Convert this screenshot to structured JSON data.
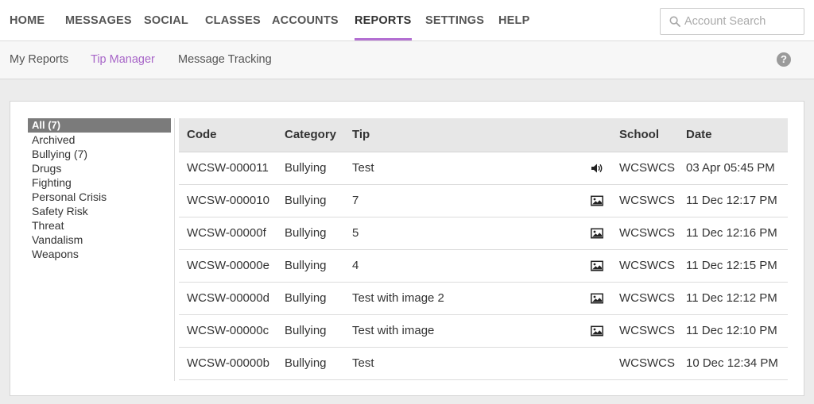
{
  "topnav": {
    "items": [
      {
        "label": "HOME",
        "active": false
      },
      {
        "label": "MESSAGES",
        "active": false
      },
      {
        "label": "SOCIAL",
        "active": false
      },
      {
        "label": "CLASSES",
        "active": false
      },
      {
        "label": "ACCOUNTS",
        "active": false
      },
      {
        "label": "REPORTS",
        "active": true
      },
      {
        "label": "SETTINGS",
        "active": false
      },
      {
        "label": "HELP",
        "active": false
      }
    ],
    "search_placeholder": "Account Search",
    "accent_color": "#b36fd2"
  },
  "subnav": {
    "items": [
      {
        "label": "My Reports",
        "active": false
      },
      {
        "label": "Tip Manager",
        "active": true
      },
      {
        "label": "Message Tracking",
        "active": false
      }
    ],
    "help_icon": "?"
  },
  "categories": [
    {
      "label": "All (7)",
      "selected": true
    },
    {
      "label": "Archived",
      "selected": false
    },
    {
      "label": "Bullying (7)",
      "selected": false
    },
    {
      "label": "Drugs",
      "selected": false
    },
    {
      "label": "Fighting",
      "selected": false
    },
    {
      "label": "Personal Crisis",
      "selected": false
    },
    {
      "label": "Safety Risk",
      "selected": false
    },
    {
      "label": "Threat",
      "selected": false
    },
    {
      "label": "Vandalism",
      "selected": false
    },
    {
      "label": "Weapons",
      "selected": false
    }
  ],
  "table": {
    "headers": {
      "code": "Code",
      "category": "Category",
      "tip": "Tip",
      "school": "School",
      "date": "Date"
    },
    "rows": [
      {
        "code": "WCSW-000011",
        "category": "Bullying",
        "tip": "Test",
        "media": "speaker-icon",
        "school": "WCSWCS",
        "date": "03 Apr 05:45 PM"
      },
      {
        "code": "WCSW-000010",
        "category": "Bullying",
        "tip": "7",
        "media": "image-icon",
        "school": "WCSWCS",
        "date": "11 Dec 12:17 PM"
      },
      {
        "code": "WCSW-00000f",
        "category": "Bullying",
        "tip": "5",
        "media": "image-icon",
        "school": "WCSWCS",
        "date": "11 Dec 12:16 PM"
      },
      {
        "code": "WCSW-00000e",
        "category": "Bullying",
        "tip": "4",
        "media": "image-icon",
        "school": "WCSWCS",
        "date": "11 Dec 12:15 PM"
      },
      {
        "code": "WCSW-00000d",
        "category": "Bullying",
        "tip": "Test with image 2",
        "media": "image-icon",
        "school": "WCSWCS",
        "date": "11 Dec 12:12 PM"
      },
      {
        "code": "WCSW-00000c",
        "category": "Bullying",
        "tip": "Test with image",
        "media": "image-icon",
        "school": "WCSWCS",
        "date": "11 Dec 12:10 PM"
      },
      {
        "code": "WCSW-00000b",
        "category": "Bullying",
        "tip": "Test",
        "media": "",
        "school": "WCSWCS",
        "date": "10 Dec 12:34 PM"
      }
    ]
  }
}
